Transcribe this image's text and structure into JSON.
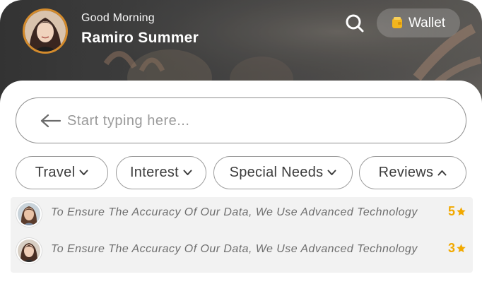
{
  "header": {
    "greeting": "Good Morning",
    "user_name": "Ramiro Summer",
    "search_icon": "search-icon",
    "wallet_label": "Wallet",
    "wallet_icon": "wallet-icon"
  },
  "search": {
    "placeholder": "Start typing here...",
    "value": "",
    "back_icon": "arrow-left-icon"
  },
  "filters": [
    {
      "label": "Travel",
      "icon": "chevron-down-icon"
    },
    {
      "label": "Interest",
      "icon": "chevron-down-icon"
    },
    {
      "label": "Special Needs",
      "icon": "chevron-down-icon"
    },
    {
      "label": "Reviews",
      "icon": "chevron-up-icon"
    }
  ],
  "reviews": [
    {
      "text": "To Ensure The Accuracy Of Our Data, We Use Advanced Technology",
      "rating": "5",
      "icon": "star-icon"
    },
    {
      "text": "To Ensure The Accuracy Of Our Data, We Use Advanced Technology",
      "rating": "3",
      "icon": "star-icon"
    }
  ],
  "colors": {
    "accent": "#f2a900",
    "avatar_ring": "#d48b2c",
    "chip_border": "#9c9c9c",
    "list_background": "#f2f2f2"
  }
}
